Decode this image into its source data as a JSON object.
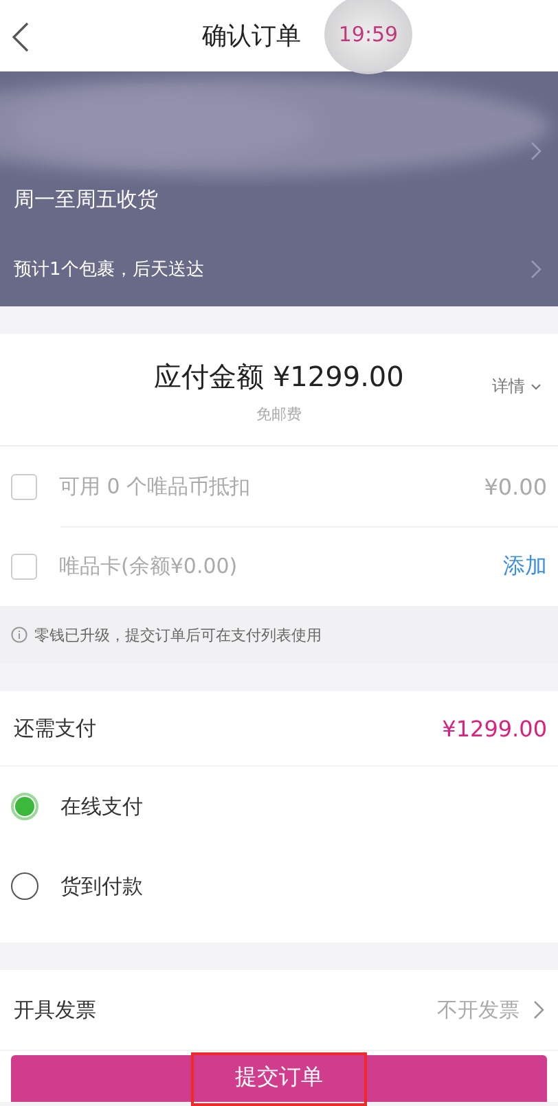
{
  "header": {
    "title": "确认订单",
    "timer": "19:59"
  },
  "address": {
    "note": "周一至周五收货",
    "delivery": "预计1个包裹，后天送达"
  },
  "amount": {
    "label": "应付金额 ¥1299.00",
    "note": "免邮费",
    "detail": "详情"
  },
  "discounts": [
    {
      "kind": "value",
      "label": "可用 0 个唯品币抵扣",
      "value": "¥0.00",
      "checked": false
    },
    {
      "kind": "action",
      "label": "唯品卡(余额¥0.00)",
      "value": "添加",
      "checked": false
    }
  ],
  "notice": "零钱已升级，提交订单后可在支付列表使用",
  "due": {
    "label": "还需支付",
    "amount": "¥1299.00"
  },
  "payment_methods": [
    {
      "label": "在线支付",
      "selected": true
    },
    {
      "label": "货到付款",
      "selected": false
    }
  ],
  "invoice": {
    "label": "开具发票",
    "value": "不开发票"
  },
  "submit": {
    "label": "提交订单",
    "highlighted": true
  }
}
